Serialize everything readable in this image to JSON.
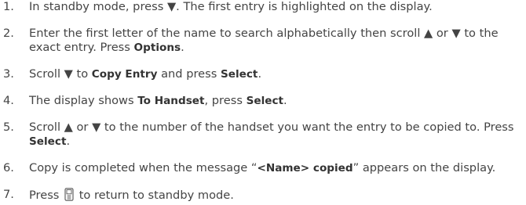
{
  "steps": [
    {
      "number": "1.",
      "parts": [
        {
          "text": "In standby mode, press ▼. The first entry is highlighted on the display."
        }
      ]
    },
    {
      "number": "2.",
      "parts": [
        {
          "text": "Enter the first letter of the name to search alphabetically then scroll ▲ or ▼ to the exact entry. Press "
        },
        {
          "text": "Options",
          "bold": true
        },
        {
          "text": "."
        }
      ]
    },
    {
      "number": "3.",
      "parts": [
        {
          "text": "Scroll ▼ to "
        },
        {
          "text": "Copy Entry",
          "bold": true
        },
        {
          "text": " and press "
        },
        {
          "text": "Select",
          "bold": true
        },
        {
          "text": "."
        }
      ]
    },
    {
      "number": "4.",
      "parts": [
        {
          "text": "The display shows "
        },
        {
          "text": "To Handset",
          "bold": true
        },
        {
          "text": ", press "
        },
        {
          "text": "Select",
          "bold": true
        },
        {
          "text": "."
        }
      ]
    },
    {
      "number": "5.",
      "parts": [
        {
          "text": "Scroll ▲ or ▼ to the number of the handset you want the entry to be copied to. Press "
        },
        {
          "text": "Select",
          "bold": true
        },
        {
          "text": "."
        }
      ]
    },
    {
      "number": "6.",
      "parts": [
        {
          "text": "Copy is completed when the message “"
        },
        {
          "text": "<Name> copied",
          "bold": true
        },
        {
          "text": "” appears on the display."
        }
      ]
    },
    {
      "number": "7.",
      "parts": [
        {
          "text": "Press "
        },
        {
          "icon": "handset-end-key-icon"
        },
        {
          "text": " to return to standby mode."
        }
      ]
    }
  ]
}
